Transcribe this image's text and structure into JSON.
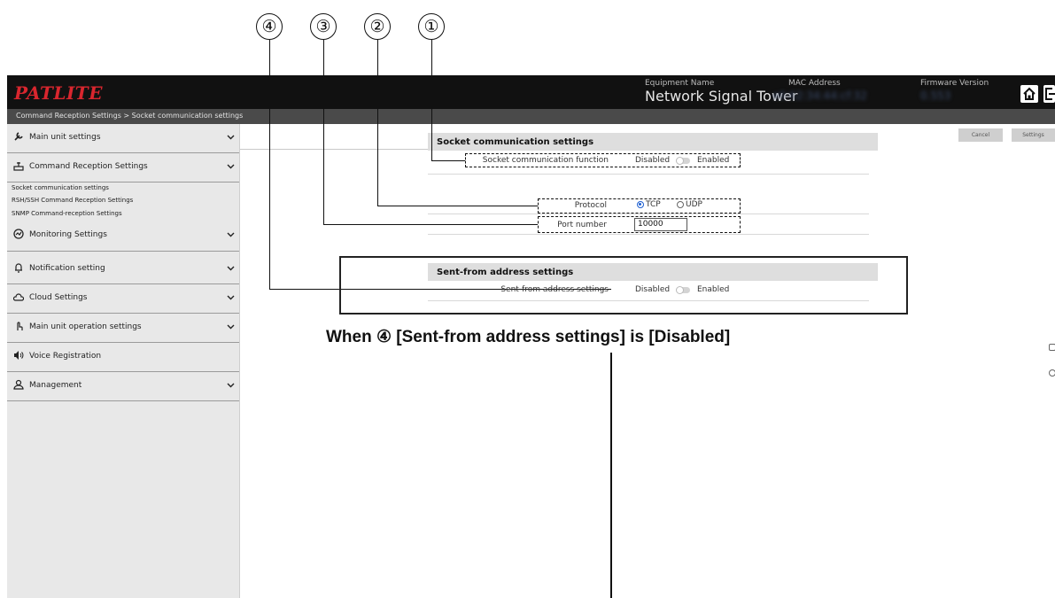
{
  "callouts": [
    "①",
    "②",
    "③",
    "④"
  ],
  "header": {
    "logo": "PATLITE",
    "equipment_name_label": "Equipment Name",
    "equipment_name": "Network Signal Tower",
    "mac_label": "MAC Address",
    "mac_value": "e0:62:34:44:cf:32",
    "firmware_label": "Firmware Version",
    "firmware_value": "0.553",
    "buttons": [
      "home-icon",
      "logout-icon"
    ]
  },
  "breadcrumb": "Command Reception Settings > Socket communication settings",
  "sidebar": {
    "items": [
      {
        "label": "Main unit settings",
        "icon": "wrench-icon"
      },
      {
        "label": "Command Reception Settings",
        "icon": "router-icon"
      },
      {
        "label": "Monitoring Settings",
        "icon": "gauge-icon"
      },
      {
        "label": "Notification setting",
        "icon": "bell-icon"
      },
      {
        "label": "Cloud Settings",
        "icon": "cloud-icon"
      },
      {
        "label": "Main unit operation settings",
        "icon": "finger-icon"
      },
      {
        "label": "Voice Registration",
        "icon": "speaker-icon"
      },
      {
        "label": "Management",
        "icon": "person-icon"
      }
    ],
    "subitems": [
      "Socket communication settings",
      "RSH/SSH Command Reception Settings",
      "SNMP Command-reception Settings"
    ]
  },
  "actions": {
    "cancel": "Cancel",
    "settings": "Settings"
  },
  "socket_section": {
    "title": "Socket communication settings",
    "function_label": "Socket communication function",
    "disabled": "Disabled",
    "enabled": "Enabled",
    "protocol_label": "Protocol",
    "protocol_tcp": "TCP",
    "protocol_udp": "UDP",
    "protocol_selected": "TCP",
    "port_label": "Port number",
    "port_value": "10000"
  },
  "sent_from_section": {
    "title": "Sent-from address settings",
    "label": "Sent-from address settings",
    "disabled": "Disabled",
    "enabled": "Enabled"
  },
  "caption": "When ④ [Sent-from address settings] is [Disabled]",
  "colors": {
    "header_bg": "#111111",
    "logo": "#d9262e",
    "sidebar_bg": "#e8e8e8",
    "radio_selected": "#1e5fd1"
  }
}
